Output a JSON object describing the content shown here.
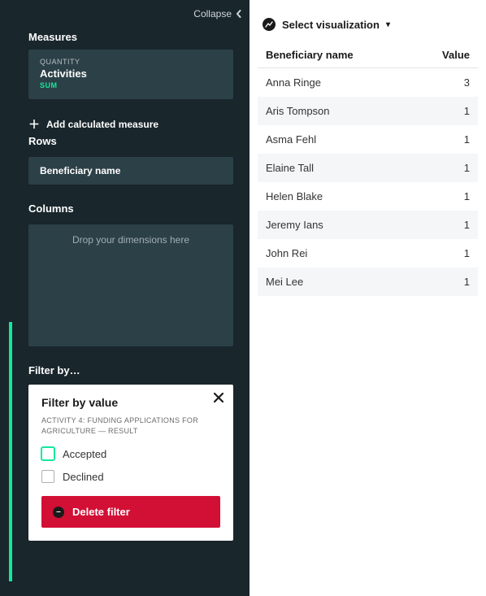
{
  "sidebar": {
    "collapse_label": "Collapse",
    "measures_title": "Measures",
    "measure": {
      "tag": "QUANTITY",
      "name": "Activities",
      "agg": "SUM"
    },
    "add_calculated_label": "Add calculated measure",
    "rows_title": "Rows",
    "row_item": "Beneficiary name",
    "columns_title": "Columns",
    "dropzone_text": "Drop your dimensions here",
    "filter_by_title": "Filter by…",
    "filter_card": {
      "heading": "Filter by value",
      "subheading": "ACTIVITY 4: FUNDING APPLICATIONS FOR AGRICULTURE — RESULT",
      "option_accepted": "Accepted",
      "option_declined": "Declined",
      "delete_label": "Delete filter"
    }
  },
  "main": {
    "select_viz_label": "Select visualization",
    "table": {
      "col_name": "Beneficiary name",
      "col_value": "Value",
      "rows": [
        {
          "name": "Anna Ringe",
          "value": "3"
        },
        {
          "name": "Aris Tompson",
          "value": "1"
        },
        {
          "name": "Asma Fehl",
          "value": "1"
        },
        {
          "name": "Elaine Tall",
          "value": "1"
        },
        {
          "name": "Helen Blake",
          "value": "1"
        },
        {
          "name": "Jeremy Ians",
          "value": "1"
        },
        {
          "name": "John Rei",
          "value": "1"
        },
        {
          "name": "Mei Lee",
          "value": "1"
        }
      ]
    }
  }
}
